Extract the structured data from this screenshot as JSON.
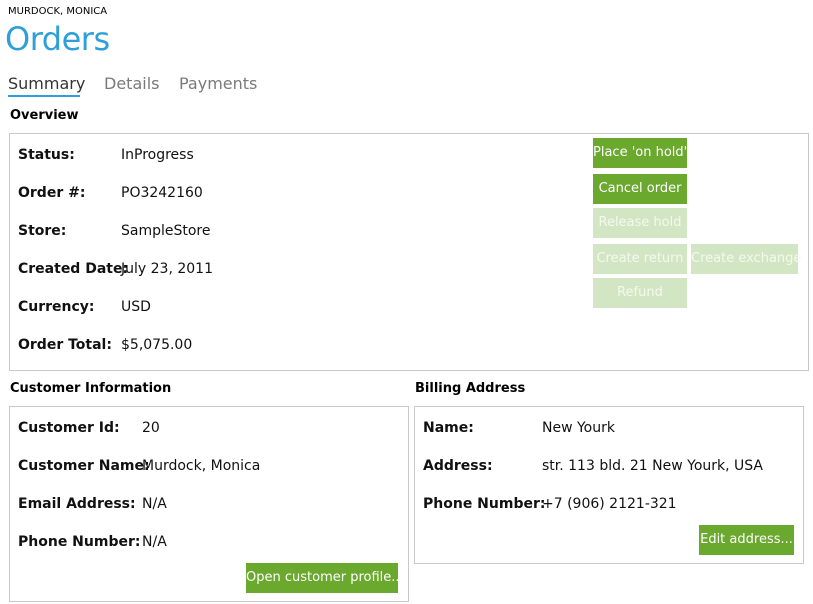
{
  "header": {
    "customer_name": "MURDOCK, MONICA",
    "title": "Orders"
  },
  "tabs": [
    {
      "label": "Summary",
      "active": true
    },
    {
      "label": "Details",
      "active": false
    },
    {
      "label": "Payments",
      "active": false
    }
  ],
  "overview": {
    "section_label": "Overview",
    "fields": [
      {
        "label": "Status:",
        "value": "InProgress"
      },
      {
        "label": "Order #:",
        "value": "PO3242160"
      },
      {
        "label": "Store:",
        "value": "SampleStore"
      },
      {
        "label": "Created Date:",
        "value": "July 23, 2011"
      },
      {
        "label": "Currency:",
        "value": "USD"
      },
      {
        "label": "Order Total:",
        "value": "$5,075.00"
      }
    ],
    "actions": {
      "place_on_hold": "Place 'on hold'",
      "cancel_order": "Cancel order",
      "release_hold": "Release hold",
      "create_return": "Create return",
      "create_exchange": "Create exchange",
      "refund": "Refund"
    }
  },
  "customer": {
    "section_label": "Customer Information",
    "fields": [
      {
        "label": "Customer Id:",
        "value": "20"
      },
      {
        "label": "Customer Name:",
        "value": "Murdock, Monica"
      },
      {
        "label": "Email Address:",
        "value": "N/A"
      },
      {
        "label": "Phone Number:",
        "value": "N/A"
      }
    ],
    "open_profile_label": "Open customer profile..."
  },
  "billing": {
    "section_label": "Billing Address",
    "fields": [
      {
        "label": "Name:",
        "value": "New Yourk"
      },
      {
        "label": "Address:",
        "value": "str. 113 bld. 21 New Yourk, USA"
      },
      {
        "label": "Phone Number:",
        "value": "+7 (906) 2121-321"
      }
    ],
    "edit_address_label": "Edit address..."
  },
  "colors": {
    "accent_blue": "#2e9fd8",
    "button_green": "#6aa82e",
    "button_green_disabled": "#d3e6c3",
    "panel_border": "#c9c9c9"
  }
}
